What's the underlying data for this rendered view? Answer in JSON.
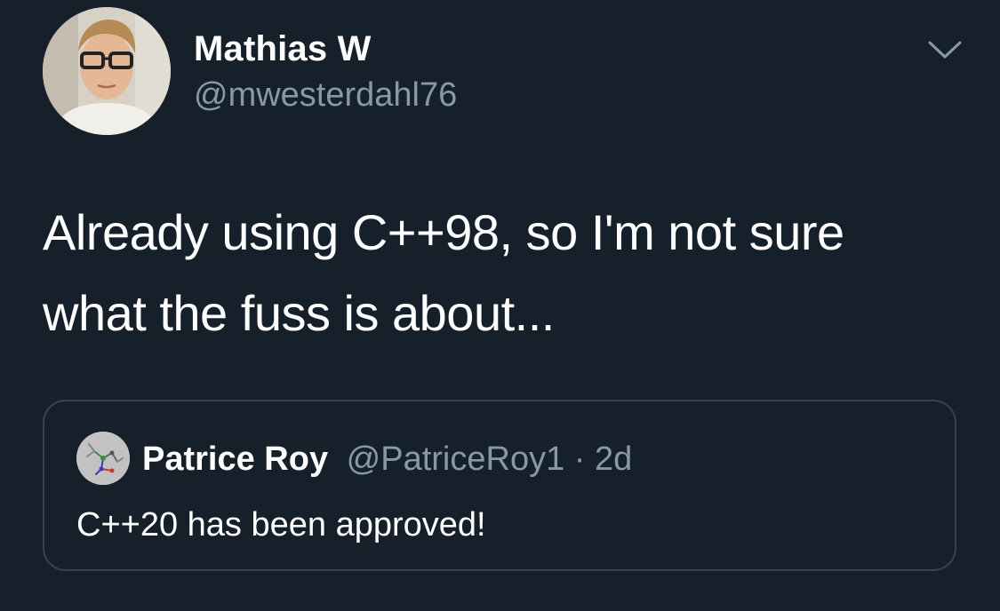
{
  "tweet": {
    "author": {
      "name": "Mathias W",
      "handle": "@mwesterdahl76",
      "avatar_icon": "person-photo-avatar"
    },
    "menu_icon": "chevron-down-icon",
    "text_line1": "Already using C++98, so I'm not sure",
    "text_line2": "what the fuss is about..."
  },
  "quoted_tweet": {
    "author": {
      "name": "Patrice Roy",
      "handle": "@PatriceRoy1",
      "avatar_icon": "molecule-avatar"
    },
    "separator": "·",
    "time": "2d",
    "text": "C++20 has been approved!"
  },
  "colors": {
    "background": "#15202b",
    "secondary_text": "#8899a6",
    "border": "#38444d"
  }
}
